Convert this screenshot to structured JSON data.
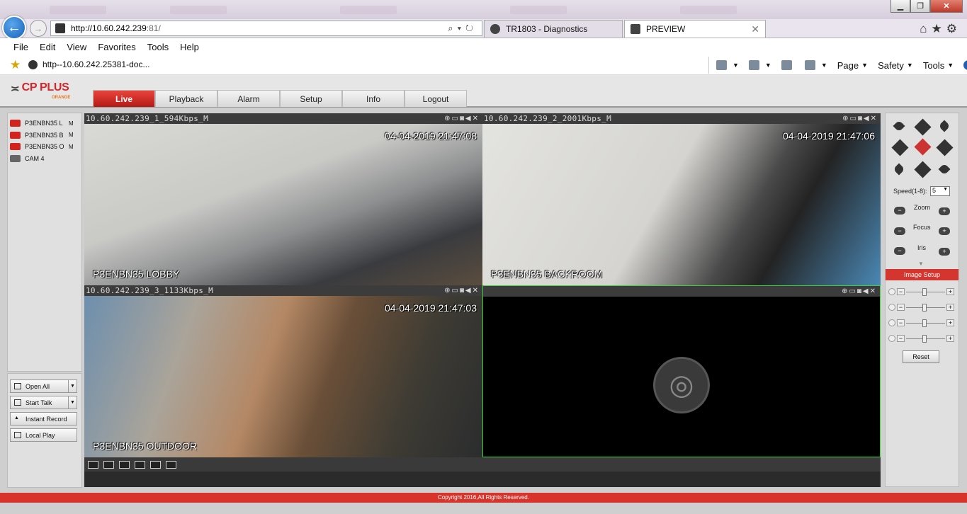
{
  "browser": {
    "url_host": "http://10.60.242.239",
    "url_rest": ":81/",
    "tabs": [
      {
        "label": "TR1803 - Diagnostics"
      },
      {
        "label": "PREVIEW"
      }
    ],
    "menu": [
      "File",
      "Edit",
      "View",
      "Favorites",
      "Tools",
      "Help"
    ],
    "favorite_item": "http--10.60.242.25381-doc...",
    "commands": [
      "Page",
      "Safety",
      "Tools"
    ]
  },
  "app": {
    "logo": "CP PLUS",
    "logo_sub": "ORANGE",
    "nav": [
      {
        "label": "Live",
        "active": true
      },
      {
        "label": "Playback"
      },
      {
        "label": "Alarm"
      },
      {
        "label": "Setup"
      },
      {
        "label": "Info"
      },
      {
        "label": "Logout"
      }
    ],
    "cameras": [
      {
        "name": "P3ENBN35 L",
        "mark": "M",
        "state": "live"
      },
      {
        "name": "P3ENBN35 B",
        "mark": "M",
        "state": "live"
      },
      {
        "name": "P3ENBN35 O",
        "mark": "M",
        "state": "live"
      },
      {
        "name": "CAM 4",
        "mark": "",
        "state": "off"
      }
    ],
    "left_buttons": [
      {
        "label": "Open All",
        "dropdown": true
      },
      {
        "label": "Start Talk",
        "dropdown": true
      },
      {
        "label": "Instant Record",
        "dropdown": false
      },
      {
        "label": "Local Play",
        "dropdown": false
      }
    ],
    "panes": [
      {
        "title": "10.60.242.239_1_594Kbps_M",
        "timestamp": "04-04-2019 21:47:08",
        "label": "P3ENBN35 LOBBY"
      },
      {
        "title": "10.60.242.239_2_2001Kbps_M",
        "timestamp": "04-04-2019 21:47:06",
        "label": "P3ENBN35 BACKROOM"
      },
      {
        "title": "10.60.242.239_3_1133Kbps_M",
        "timestamp": "04-04-2019 21:47:03",
        "label": "P3ENBN35 OUTDOOR"
      },
      {
        "title": "",
        "timestamp": "",
        "label": ""
      }
    ],
    "ptz": {
      "speed_label": "Speed(1-8):",
      "speed_value": "5",
      "zoom_label": "Zoom",
      "focus_label": "Focus",
      "iris_label": "Iris"
    },
    "image_setup": {
      "title": "Image Setup",
      "reset_label": "Reset"
    },
    "footer": "Copyright 2016,All Rights Reserved."
  }
}
